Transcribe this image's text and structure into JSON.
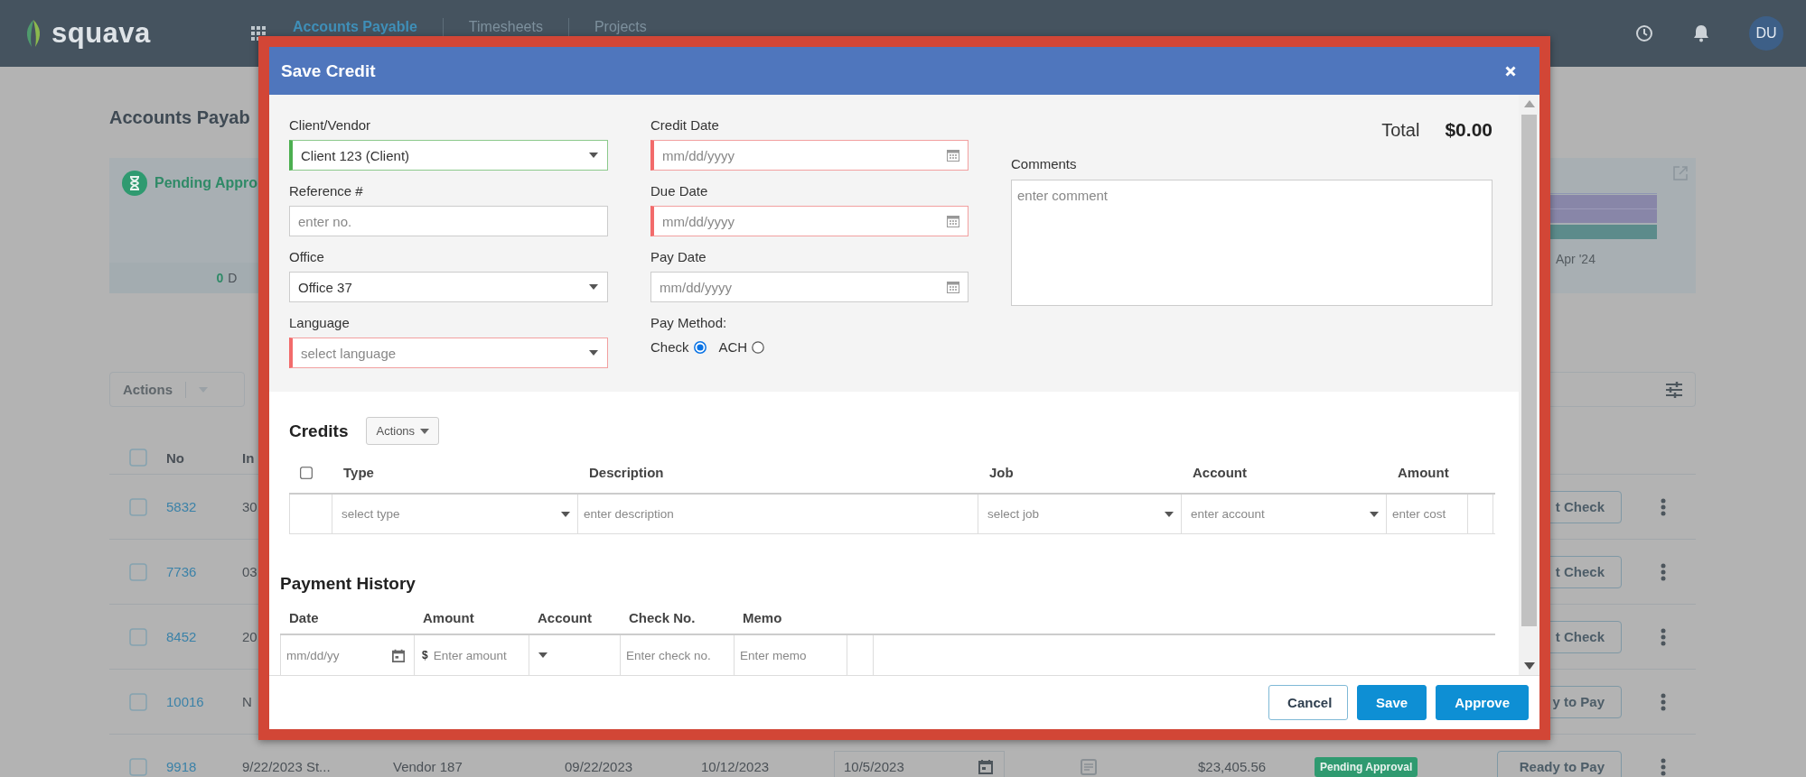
{
  "top_bar": {
    "logo": "squava",
    "nav": [
      {
        "label": "Accounts Payable",
        "selected": true
      },
      {
        "label": "Timesheets",
        "selected": false
      },
      {
        "label": "Projects",
        "selected": false
      }
    ],
    "avatar": "DU"
  },
  "page": {
    "title": "Accounts Payab",
    "summary_card": {
      "title": "Pending Appro",
      "count": "0",
      "count_label": "D"
    },
    "chart_card": {
      "axis_label": "Apr '24"
    },
    "toolbar": {
      "actions": "Actions"
    },
    "table": {
      "select_all": {
        "checked": false
      },
      "columns": [
        "No",
        "In"
      ],
      "rows": [
        {
          "kind": "covered",
          "checked": false,
          "no": "5832",
          "col_2": "30",
          "action": "t Check"
        },
        {
          "kind": "covered",
          "checked": false,
          "no": "7736",
          "col_2": "03",
          "action": "t Check"
        },
        {
          "kind": "covered",
          "checked": false,
          "no": "8452",
          "col_2": "20",
          "action": "t Check"
        },
        {
          "kind": "covered",
          "checked": false,
          "no": "10016",
          "col_2": "N",
          "action": "y to Pay"
        },
        {
          "kind": "full",
          "checked": false,
          "no": "9918",
          "col_2": "9/22/2023 St...",
          "vendor": "Vendor 187",
          "date_1": "09/22/2023",
          "date_2": "10/12/2023",
          "pay_date": "10/5/2023",
          "amount": "$23,405.56",
          "status": "Pending Approval",
          "action": "Ready to Pay"
        }
      ]
    }
  },
  "dialog": {
    "title": "Save Credit",
    "fields": [
      {
        "label": "Client/Vendor",
        "kind": "select",
        "value": "Client 123 (Client)",
        "confirmed": true,
        "error": false
      },
      {
        "label": "Reference #",
        "kind": "text",
        "placeholder": "enter no.",
        "confirmed": false,
        "error": false
      },
      {
        "label": "Office",
        "kind": "select",
        "value": "Office 37",
        "confirmed": false,
        "error": false
      },
      {
        "label": "Language",
        "kind": "select",
        "placeholder": "select language",
        "confirmed": false,
        "error": true
      }
    ],
    "dates": [
      {
        "label": "Credit Date",
        "placeholder": "mm/dd/yyyy",
        "confirmed": false,
        "error": true
      },
      {
        "label": "Due Date",
        "placeholder": "mm/dd/yyyy",
        "confirmed": false,
        "error": true
      },
      {
        "label": "Pay Date",
        "placeholder": "mm/dd/yyyy",
        "confirmed": false,
        "error": false
      }
    ],
    "pay_method": {
      "label": "Pay Method:",
      "options": [
        {
          "label": "Check",
          "selected": true
        },
        {
          "label": "ACH",
          "selected": false
        }
      ]
    },
    "total": {
      "label": "Total",
      "value": "$0.00"
    },
    "comments": {
      "label": "Comments",
      "placeholder": "enter comment"
    },
    "credits": {
      "title": "Credits",
      "actions": "Actions",
      "select_all": {
        "checked": false
      },
      "columns": [
        "Type",
        "Description",
        "Job",
        "Account",
        "Amount"
      ],
      "row": [
        {
          "kind": "select",
          "placeholder": "select type"
        },
        {
          "kind": "text",
          "placeholder": "enter description"
        },
        {
          "kind": "select",
          "placeholder": "select job"
        },
        {
          "kind": "select",
          "placeholder": "enter account"
        },
        {
          "kind": "text",
          "placeholder": "enter cost"
        }
      ]
    },
    "payment_history": {
      "title": "Payment History",
      "columns": [
        "Date",
        "Amount",
        "Account",
        "Check No.",
        "Memo"
      ],
      "row": [
        {
          "kind": "date",
          "placeholder": "mm/dd/yy"
        },
        {
          "kind": "money",
          "prefix": "$",
          "placeholder": "Enter amount"
        },
        {
          "kind": "select"
        },
        {
          "kind": "text",
          "placeholder": "Enter check no."
        },
        {
          "kind": "text",
          "placeholder": "Enter memo"
        }
      ]
    },
    "buttons": [
      {
        "label": "Cancel",
        "kind": "secondary"
      },
      {
        "label": "Save",
        "kind": "primary"
      },
      {
        "label": "Approve",
        "kind": "primary"
      }
    ]
  }
}
